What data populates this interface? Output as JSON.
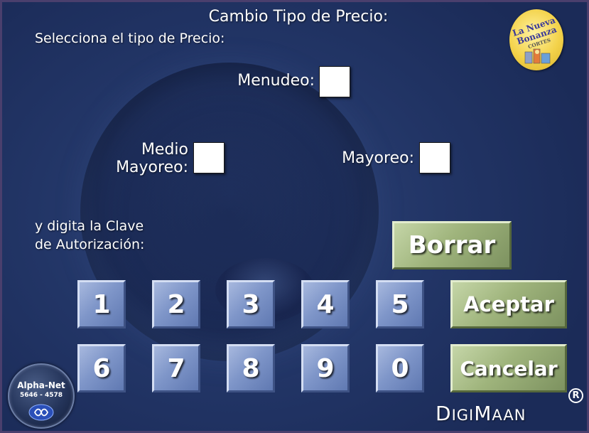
{
  "dialog": {
    "title": "Cambio Tipo de Precio:",
    "subtitle": "Selecciona el tipo de Precio:",
    "prompt_line1": "y digita la Clave",
    "prompt_line2": "de Autorización:"
  },
  "price_options": {
    "menudeo": "Menudeo:",
    "medio_line1": "Medio",
    "medio_line2": "Mayoreo:",
    "mayoreo": "Mayoreo:"
  },
  "keypad": {
    "row1": [
      "1",
      "2",
      "3",
      "4",
      "5"
    ],
    "row2": [
      "6",
      "7",
      "8",
      "9",
      "0"
    ]
  },
  "actions": {
    "borrar": "Borrar",
    "aceptar": "Aceptar",
    "cancelar": "Cancelar"
  },
  "logos": {
    "store_line1": "La Nueva",
    "store_line2": "Bonanza",
    "store_sub": "CORTES",
    "vendor_name": "Alpha-Net",
    "vendor_phone": "5646 - 4578",
    "brand_d": "D",
    "brand_igi": "IGI",
    "brand_m": "M",
    "brand_aan": "AAN",
    "registered": "R"
  },
  "colors": {
    "background": "#223566",
    "keypad_blue": "#7f96c9",
    "action_green": "#9fb47c",
    "store_logo_yellow": "#f3d24a"
  }
}
